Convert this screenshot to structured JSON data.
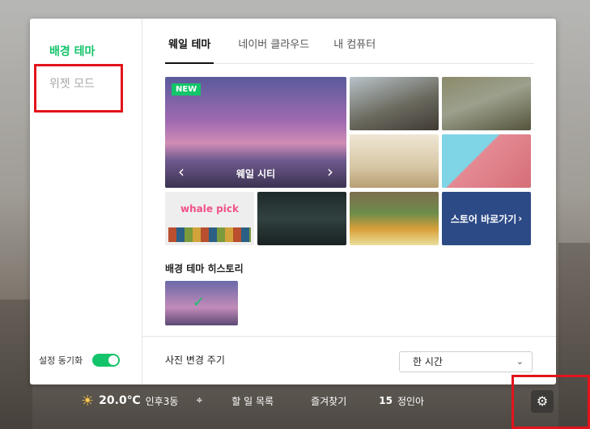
{
  "sidebar": {
    "items": [
      {
        "label": "배경 테마",
        "active": true
      },
      {
        "label": "위젯 모드",
        "active": false
      }
    ],
    "sync_label": "설정 동기화",
    "sync_enabled": true
  },
  "tabs": [
    {
      "label": "웨일 테마",
      "active": true
    },
    {
      "label": "네이버 클라우드",
      "active": false
    },
    {
      "label": "내 컴퓨터",
      "active": false
    }
  ],
  "featured": {
    "badge": "NEW",
    "title": "웨일 시티",
    "prev_icon": "chevron-left-icon",
    "next_icon": "chevron-right-icon"
  },
  "tiles": {
    "whale_pick": "whale pick",
    "store_link": "스토어 바로가기"
  },
  "history": {
    "label": "배경 테마 히스토리"
  },
  "photo_change": {
    "label": "사진 변경 주기",
    "selected": "한 시간"
  },
  "taskbar": {
    "temperature": "20.0℃",
    "location": "인후3동",
    "todo": "할 일 목록",
    "favorites": "즐겨찾기",
    "date_num": "15",
    "day_label": "정인아"
  },
  "colors": {
    "accent": "#14c46a",
    "highlight_box": "#e3141b"
  }
}
